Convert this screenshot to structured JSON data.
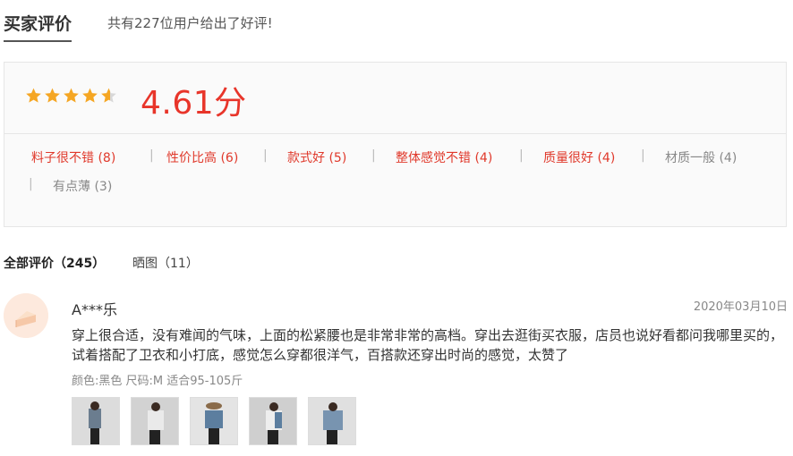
{
  "header": {
    "title": "买家评价",
    "summary": "共有227位用户给出了好评!"
  },
  "rating": {
    "score": "4.61分",
    "stars_filled": 4.61,
    "star_color": "#f5a623"
  },
  "tags": [
    {
      "label": "料子很不错 (8)",
      "color": "red"
    },
    {
      "label": "性价比高 (6)",
      "color": "red"
    },
    {
      "label": "款式好 (5)",
      "color": "red"
    },
    {
      "label": "整体感觉不错 (4)",
      "color": "red"
    },
    {
      "label": "质量很好 (4)",
      "color": "red"
    },
    {
      "label": "材质一般 (4)",
      "color": "gray"
    },
    {
      "label": "有点薄 (3)",
      "color": "gray"
    }
  ],
  "filters": {
    "all": "全部评价（245）",
    "pics": "晒图（11）"
  },
  "review": {
    "user": "A***乐",
    "date": "2020年03月10日",
    "content": "穿上很合适，没有难闻的气味，上面的松紧腰也是非常非常的高档。穿出去逛街买衣服，店员也说好看都问我哪里买的，试着搭配了卫衣和小打底，感觉怎么穿都很洋气，百搭款还穿出时尚的感觉，太赞了",
    "meta": "颜色:黑色 尺码:M 适合95-105斤",
    "photos": 5
  }
}
